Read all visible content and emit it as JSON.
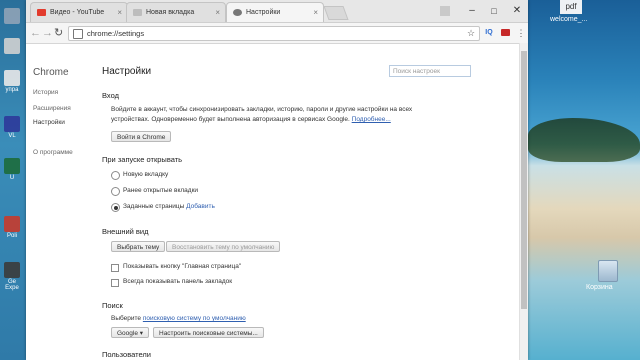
{
  "desktop": {
    "left_labels": [
      "упра",
      "VL",
      "U",
      "Poli",
      "Ge Expe"
    ],
    "right": {
      "pdf_label": "pdf",
      "welcome_label": "welcome_...",
      "recycle_bin": "Корзина"
    }
  },
  "browser": {
    "tabs": [
      {
        "title": "Видео - YouTube",
        "icon_color": "#e23b2d"
      },
      {
        "title": "Новая вкладка",
        "icon_color": "#bdbdbd"
      },
      {
        "title": "Настройки",
        "icon_color": "#777777"
      }
    ],
    "address": "chrome://settings"
  },
  "settings": {
    "brand": "Chrome",
    "sidebar": [
      "История",
      "Расширения",
      "Настройки",
      "О программе"
    ],
    "title": "Настройки",
    "search_placeholder": "Поиск настроек",
    "signin": {
      "title": "Вход",
      "text1": "Войдите в аккаунт, чтобы синхронизировать закладки, историю, пароли и другие настройки на всех",
      "text2": "устройствах. Одновременно будет выполнена авторизация в сервисах Google.",
      "more_link": "Подробнее...",
      "button": "Войти в Chrome"
    },
    "startup": {
      "title": "При запуске открывать",
      "options": [
        "Новую вкладку",
        "Ранее открытые вкладки",
        "Заданные страницы"
      ],
      "add_link": "Добавить",
      "selected": 2
    },
    "appearance": {
      "title": "Внешний вид",
      "choose_theme": "Выбрать тему",
      "reset_theme": "Восстановить тему по умолчанию",
      "home_button": "Показывать кнопку \"Главная страница\"",
      "bookmarks_bar": "Всегда показывать панель закладок"
    },
    "search": {
      "title": "Поиск",
      "text": "Выберите",
      "link": "поисковую систему по умолчанию",
      "engine": "Google",
      "manage": "Настроить поисковые системы..."
    },
    "users": {
      "title": "Пользователи"
    }
  }
}
